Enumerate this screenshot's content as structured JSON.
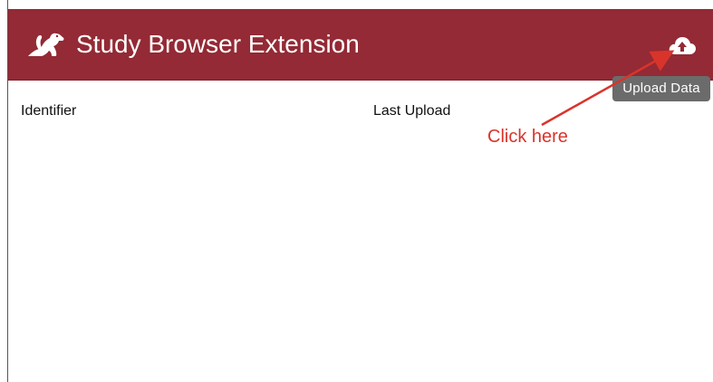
{
  "header": {
    "title": "Study Browser Extension",
    "background_color": "#932a35",
    "logo_icon": "chipmunk-logo-icon",
    "upload_icon": "cloud-upload-icon"
  },
  "tooltip": {
    "label": "Upload Data"
  },
  "table": {
    "columns": [
      "Identifier",
      "Last Upload"
    ],
    "rows": []
  },
  "annotation": {
    "text": "Click here",
    "color": "#d9342b"
  }
}
